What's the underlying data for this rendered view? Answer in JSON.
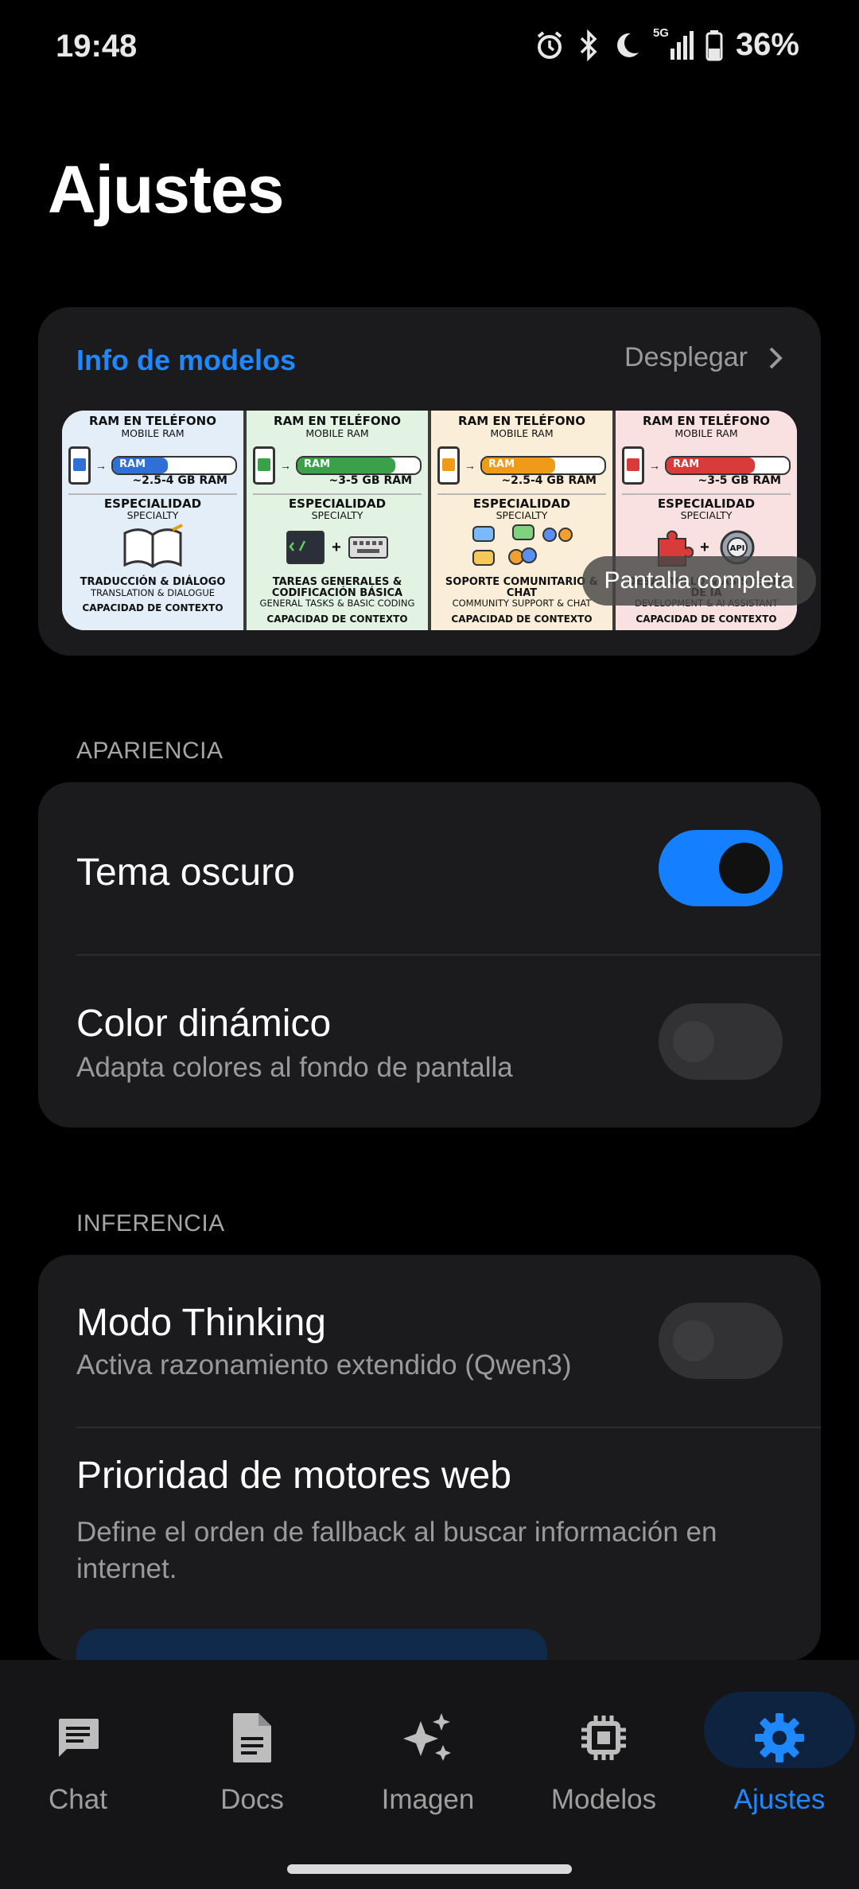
{
  "status_bar": {
    "time": "19:48",
    "network": "5G",
    "battery": "36%"
  },
  "page": {
    "title": "Ajustes"
  },
  "models_card": {
    "title": "Info de modelos",
    "expand_label": "Desplegar",
    "fullscreen_label": "Pantalla completa",
    "panels": [
      {
        "header": "RAM EN TELÉFONO",
        "header_sub": "MOBILE RAM",
        "ram_label": "RAM",
        "ram": "~2.5-4 GB RAM",
        "spec": "ESPECIALIDAD",
        "spec_sub": "SPECIALTY",
        "task": "TRADUCCIÓN & DIÁLOGO",
        "task_sub": "TRANSLATION & DIALOGUE",
        "color": "#2f6fd6",
        "bg": "#e3eef9",
        "fill": 0.45
      },
      {
        "header": "RAM EN TELÉFONO",
        "header_sub": "MOBILE RAM",
        "ram_label": "RAM",
        "ram": "~3-5 GB RAM",
        "spec": "ESPECIALIDAD",
        "spec_sub": "SPECIALTY",
        "task": "TAREAS GENERALES & CODIFICACIÓN BÁSICA",
        "task_sub": "GENERAL TASKS & BASIC CODING",
        "color": "#3aa04a",
        "bg": "#e2f3e4",
        "fill": 0.8
      },
      {
        "header": "RAM EN TELÉFONO",
        "header_sub": "MOBILE RAM",
        "ram_label": "RAM",
        "ram": "~2.5-4 GB RAM",
        "spec": "ESPECIALIDAD",
        "spec_sub": "SPECIALTY",
        "task": "SOPORTE COMUNITARIO & CHAT",
        "task_sub": "COMMUNITY SUPPORT & CHAT",
        "color": "#f09a1a",
        "bg": "#fbeed8",
        "fill": 0.6
      },
      {
        "header": "RAM EN TELÉFONO",
        "header_sub": "MOBILE RAM",
        "ram_label": "RAM",
        "ram": "~3-5 GB RAM",
        "spec": "ESPECIALIDAD",
        "spec_sub": "SPECIALTY",
        "task": "DESARROLLO & ASISTENTE DE IA",
        "task_sub": "DEVELOPMENT & AI ASSISTANT",
        "color": "#d93a3a",
        "bg": "#f9e1e1",
        "fill": 0.72
      }
    ],
    "cut_text": "CAPACIDAD DE CONTEXTO"
  },
  "appearance": {
    "section_label": "APARIENCIA",
    "dark_theme": {
      "title": "Tema oscuro",
      "enabled": true
    },
    "dynamic_color": {
      "title": "Color dinámico",
      "subtitle": "Adapta colores al fondo de pantalla",
      "enabled": false
    }
  },
  "inference": {
    "section_label": "INFERENCIA",
    "thinking": {
      "title": "Modo Thinking",
      "subtitle": "Activa razonamiento extendido (Qwen3)",
      "enabled": false
    },
    "web_engines": {
      "title": "Prioridad de motores web",
      "subtitle": "Define el orden de fallback al buscar información en internet."
    }
  },
  "bottom_nav": {
    "items": [
      {
        "label": "Chat",
        "icon": "chat-icon"
      },
      {
        "label": "Docs",
        "icon": "document-icon"
      },
      {
        "label": "Imagen",
        "icon": "sparkle-icon"
      },
      {
        "label": "Modelos",
        "icon": "chip-icon"
      },
      {
        "label": "Ajustes",
        "icon": "gear-icon",
        "active": true
      }
    ]
  },
  "colors": {
    "accent": "#1e88ff",
    "card": "#1b1b1d",
    "background": "#000000"
  }
}
